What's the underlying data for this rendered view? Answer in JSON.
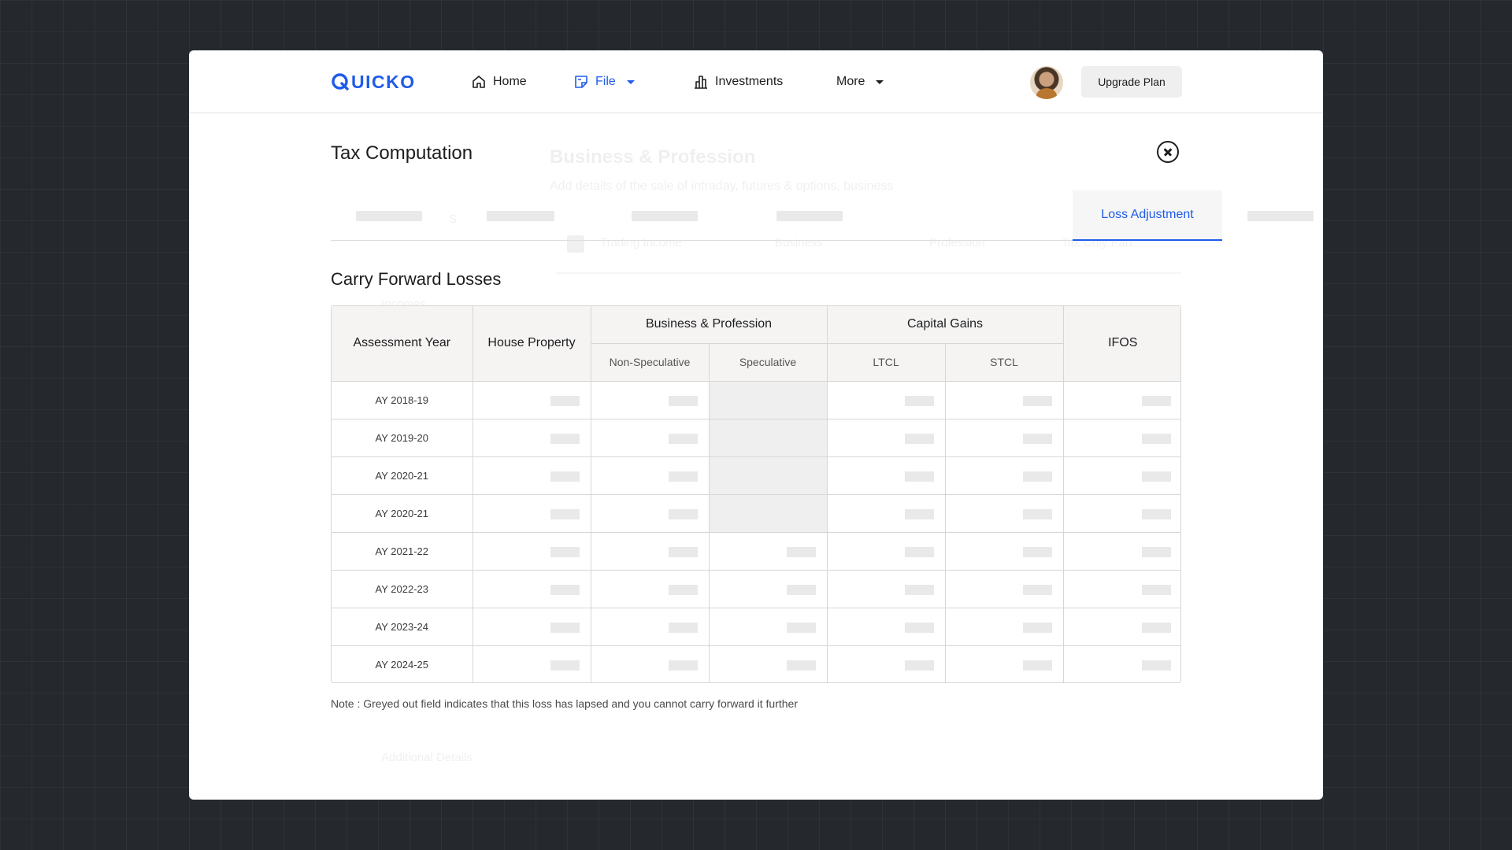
{
  "app": {
    "logo_text": "UICKO",
    "brand_color": "#1f5bea"
  },
  "nav": {
    "home": "Home",
    "file": "File",
    "investments": "Investments",
    "more": "More",
    "upgrade": "Upgrade Plan",
    "active_item": "File"
  },
  "background_page": {
    "title": "Business & Profession",
    "subtitle": "Add details of the sale of intraday, futures & options, business",
    "initial": "S",
    "tabs": [
      "Trading Income",
      "Business",
      "Profession",
      "Tax Only Part"
    ],
    "income_label": "Incomes",
    "additional_label": "Additional Details"
  },
  "modal": {
    "title": "Tax Computation",
    "active_tab": "Loss Adjustment",
    "section_title": "Carry Forward Losses",
    "table": {
      "col_assessment_year": "Assessment Year",
      "col_house_property": "House Property",
      "group_business": "Business & Profession",
      "group_capital_gains": "Capital Gains",
      "col_ifos": "IFOS",
      "sub_non_speculative": "Non-Speculative",
      "sub_speculative": "Speculative",
      "sub_ltcl": "LTCL",
      "sub_stcl": "STCL",
      "rows": [
        {
          "ay": "AY 2018-19",
          "speculative_lapsed": true
        },
        {
          "ay": "AY 2019-20",
          "speculative_lapsed": true
        },
        {
          "ay": "AY 2020-21",
          "speculative_lapsed": true
        },
        {
          "ay": "AY 2020-21",
          "speculative_lapsed": true
        },
        {
          "ay": "AY 2021-22",
          "speculative_lapsed": false
        },
        {
          "ay": "AY 2022-23",
          "speculative_lapsed": false
        },
        {
          "ay": "AY 2023-24",
          "speculative_lapsed": false
        },
        {
          "ay": "AY 2024-25",
          "speculative_lapsed": false
        }
      ]
    },
    "note": "Note : Greyed out field indicates that this loss has lapsed and you cannot carry forward it further"
  }
}
